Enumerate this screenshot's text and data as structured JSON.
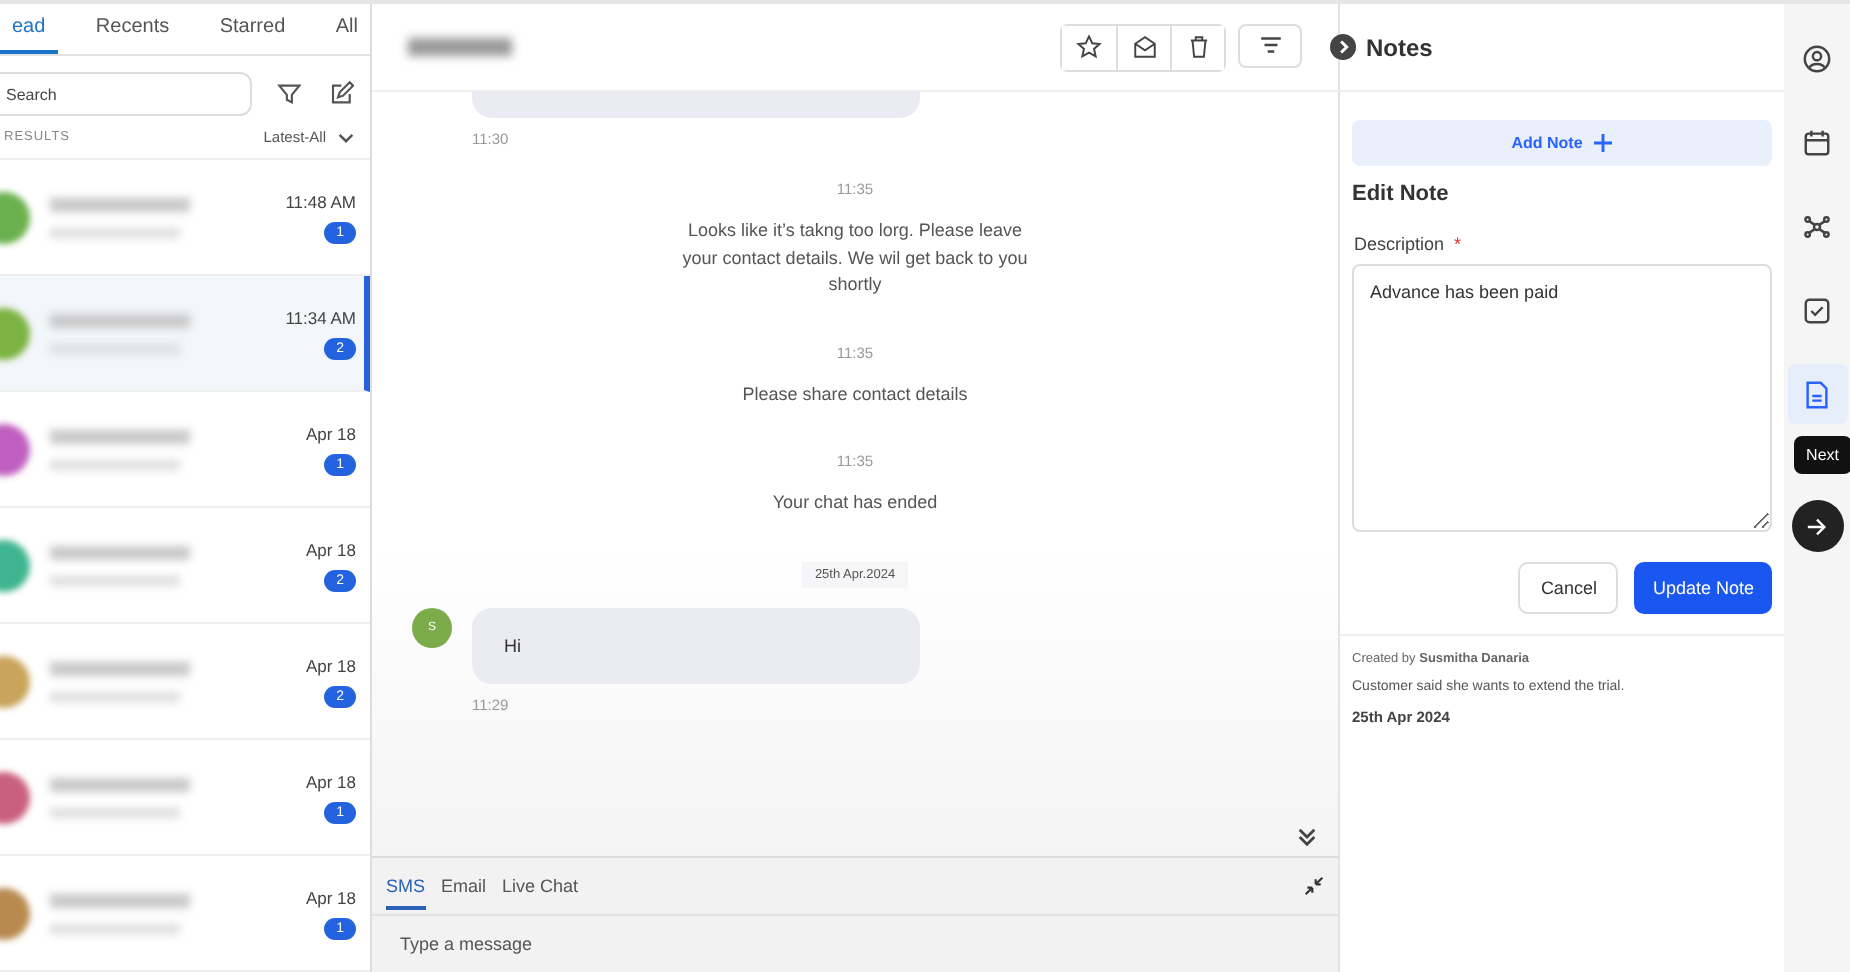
{
  "inbox_tabs": [
    {
      "label": "ead",
      "selected": true
    },
    {
      "label": "Recents",
      "selected": false
    },
    {
      "label": "Starred",
      "selected": false
    },
    {
      "label": "All",
      "selected": false
    }
  ],
  "search": {
    "placeholder": "Search"
  },
  "results_label": "RESULTS",
  "sort": "Latest-All",
  "conversations": [
    {
      "time": "11:48 AM",
      "count": "1",
      "color": "#6ab04c",
      "selected": false
    },
    {
      "time": "11:34 AM",
      "count": "2",
      "color": "#7cb342",
      "selected": true
    },
    {
      "time": "Apr 18",
      "count": "1",
      "color": "#c05fc0",
      "selected": false
    },
    {
      "time": "Apr 18",
      "count": "2",
      "color": "#3fb58f",
      "selected": false
    },
    {
      "time": "Apr 18",
      "count": "2",
      "color": "#c9a45a",
      "selected": false
    },
    {
      "time": "Apr 18",
      "count": "1",
      "color": "#c9607f",
      "selected": false
    },
    {
      "time": "Apr 18",
      "count": "1",
      "color": "#b98a50",
      "selected": false
    }
  ],
  "messages": [
    {
      "kind": "incoming",
      "time": "11:30"
    },
    {
      "kind": "system",
      "time": "11:35",
      "text": "Looks like it’s takng too lorg. Please leave your contact details. We wil get back to you shortly"
    },
    {
      "kind": "system",
      "time": "11:35",
      "text": "Please share contact details"
    },
    {
      "kind": "system",
      "time": "11:35",
      "text": "Your chat has ended"
    },
    {
      "kind": "date",
      "text": "25th Apr.2024"
    },
    {
      "kind": "incoming",
      "avatar": "S",
      "text": "Hi",
      "time": "11:29"
    }
  ],
  "composer": {
    "tabs": [
      {
        "label": "SMS",
        "selected": true
      },
      {
        "label": "Email",
        "selected": false
      },
      {
        "label": "Live Chat",
        "selected": false
      }
    ],
    "placeholder": "Type a message"
  },
  "notes": {
    "title": "Notes",
    "add_button": "Add Note",
    "heading": "Edit Note",
    "field_label": "Description",
    "required_mark": "*",
    "value": "Advance has been paid",
    "cancel": "Cancel",
    "submit": "Update Note",
    "note": {
      "author": "Created by **Susmitha Danaria**",
      "text": "Customer said she wants to extend the trial.",
      "date": "25th Apr 2024"
    }
  },
  "rail": [
    {
      "kind": "user",
      "selected": false
    },
    {
      "kind": "calendar",
      "selected": false
    },
    {
      "kind": "network",
      "selected": false
    },
    {
      "kind": "task",
      "selected": false
    },
    {
      "kind": "notes",
      "selected": true
    }
  ],
  "tooltip": "Next"
}
